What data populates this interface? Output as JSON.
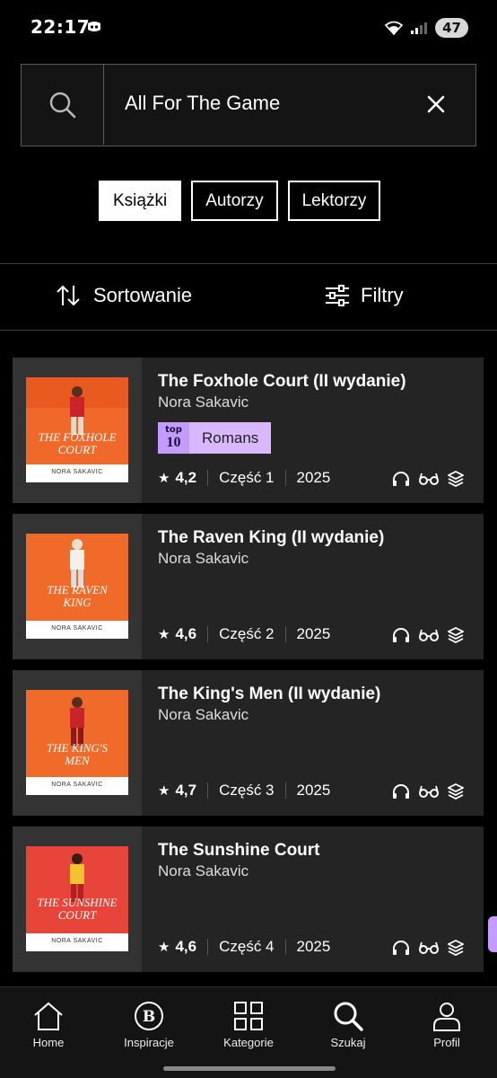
{
  "status_bar": {
    "time": "22:17",
    "battery": "47"
  },
  "search": {
    "value": "All For The Game"
  },
  "tabs": [
    {
      "label": "Książki",
      "active": true
    },
    {
      "label": "Autorzy",
      "active": false
    },
    {
      "label": "Lektorzy",
      "active": false
    }
  ],
  "controls": {
    "sort_label": "Sortowanie",
    "filter_label": "Filtry"
  },
  "books": [
    {
      "title": "The Foxhole Court (II wydanie)",
      "author": "Nora Sakavic",
      "top10": {
        "logo_top": "top",
        "logo_num": "10",
        "category": "Romans"
      },
      "rating": "4,2",
      "part": "Część 1",
      "year": "2025",
      "cover_title": "THE FOXHOLE COURT",
      "cover_author": "NORA SAKAVIC",
      "cover_color": "#f0692a"
    },
    {
      "title": "The Raven King (II wydanie)",
      "author": "Nora Sakavic",
      "rating": "4,6",
      "part": "Część 2",
      "year": "2025",
      "cover_title": "THE RAVEN KING",
      "cover_author": "NORA SAKAVIC",
      "cover_color": "#f06a2a"
    },
    {
      "title": "The King's Men (II wydanie)",
      "author": "Nora Sakavic",
      "rating": "4,7",
      "part": "Część 3",
      "year": "2025",
      "cover_title": "THE KING'S MEN",
      "cover_author": "NORA SAKAVIC",
      "cover_color": "#f06a2a"
    },
    {
      "title": "The Sunshine Court",
      "author": "Nora Sakavic",
      "rating": "4,6",
      "part": "Część 4",
      "year": "2025",
      "cover_title": "THE SUNSHINE COURT",
      "cover_author": "NORA SAKAVIC",
      "cover_color": "#e8453a"
    }
  ],
  "nav": [
    {
      "label": "Home",
      "icon": "home-icon"
    },
    {
      "label": "Inspiracje",
      "icon": "inspiration-icon"
    },
    {
      "label": "Kategorie",
      "icon": "grid-icon"
    },
    {
      "label": "Szukaj",
      "icon": "search-icon",
      "active": true
    },
    {
      "label": "Profil",
      "icon": "profile-icon"
    }
  ],
  "colors": {
    "background": "#000000",
    "card": "#242424",
    "accent": "#c49bff"
  }
}
